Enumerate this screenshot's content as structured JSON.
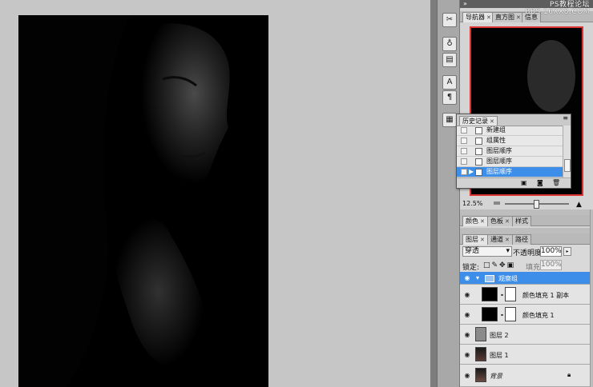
{
  "watermark": "PS教程论坛\nBBS.16XX8.COM",
  "dock": {
    "nav_tabs": [
      "导航器",
      "直方图",
      "信息"
    ],
    "zoom": "12.5%"
  },
  "history": {
    "tab": "历史记录",
    "items": [
      {
        "label": "新建组",
        "selected": false
      },
      {
        "label": "组属性",
        "selected": false
      },
      {
        "label": "图层顺序",
        "selected": false
      },
      {
        "label": "图层顺序",
        "selected": false
      },
      {
        "label": "图层顺序",
        "selected": true
      }
    ]
  },
  "color_tabs": [
    "颜色",
    "色板",
    "样式"
  ],
  "layers_panel": {
    "tabs": [
      "图层",
      "通道",
      "路径"
    ],
    "blend_mode": "穿透",
    "opacity_label": "不透明度:",
    "opacity_value": "100%",
    "lock_label": "锁定:",
    "fill_label": "填充:",
    "fill_value": "100%",
    "layers": [
      {
        "name": "观察组",
        "type": "group",
        "selected": true
      },
      {
        "name": "颜色填充 1 副本",
        "type": "fill"
      },
      {
        "name": "颜色填充 1",
        "type": "fill"
      },
      {
        "name": "图层 2",
        "type": "gray"
      },
      {
        "name": "图层 1",
        "type": "photo"
      },
      {
        "name": "背景",
        "type": "photo",
        "locked": true
      }
    ]
  },
  "colors": {
    "selection": "#3d8ee8",
    "panel": "#d4d4d4",
    "nav_frame": "#dd3333"
  }
}
